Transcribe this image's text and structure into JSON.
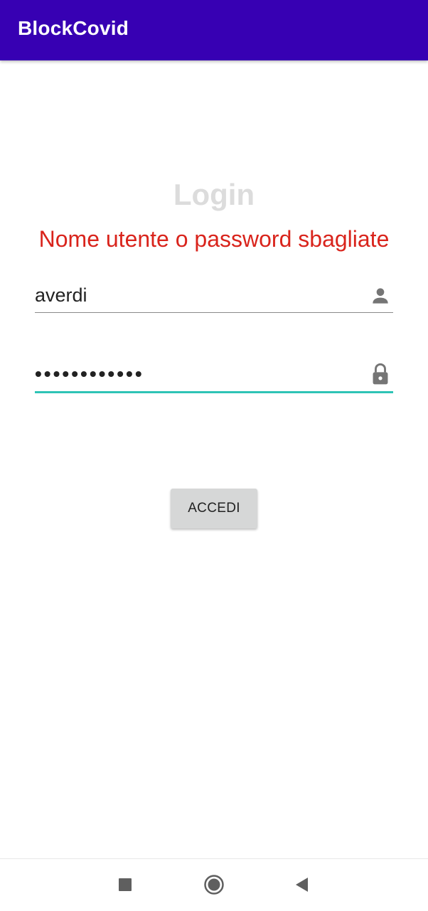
{
  "app_bar": {
    "title": "BlockCovid",
    "color": "#3700b3"
  },
  "login": {
    "heading": "Login",
    "error_message": "Nome utente o password sbagliate",
    "error_color": "#d9241c",
    "username": {
      "value": "averdi",
      "icon": "person-icon"
    },
    "password": {
      "value": "••••••••••••",
      "icon": "lock-icon",
      "focused": true,
      "accent_color": "#2ec4b6"
    },
    "submit_label": "ACCEDI"
  },
  "nav_bar": {
    "buttons": [
      "recents-icon",
      "home-icon",
      "back-icon"
    ]
  }
}
